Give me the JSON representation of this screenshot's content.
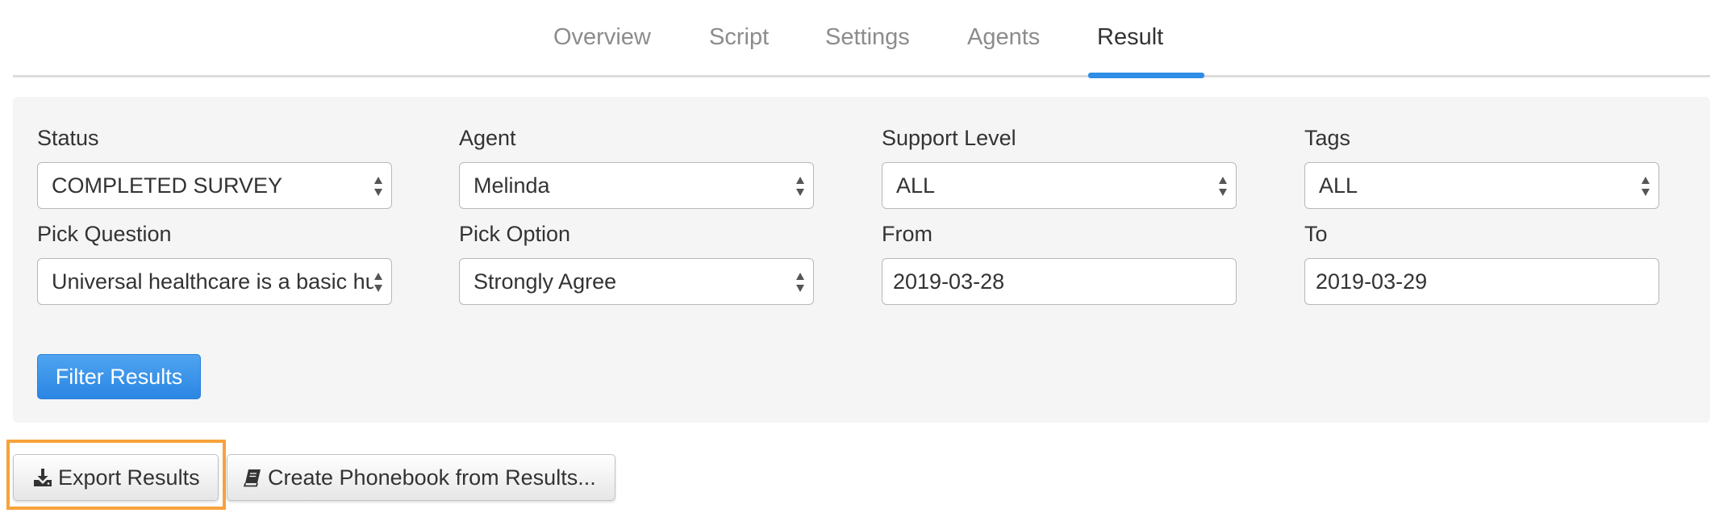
{
  "tabs": [
    {
      "label": "Overview",
      "active": false
    },
    {
      "label": "Script",
      "active": false
    },
    {
      "label": "Settings",
      "active": false
    },
    {
      "label": "Agents",
      "active": false
    },
    {
      "label": "Result",
      "active": true
    }
  ],
  "filters": {
    "status": {
      "label": "Status",
      "value": "COMPLETED SURVEY"
    },
    "agent": {
      "label": "Agent",
      "value": "Melinda"
    },
    "support_level": {
      "label": "Support Level",
      "value": "ALL"
    },
    "tags": {
      "label": "Tags",
      "value": "ALL"
    },
    "pick_question": {
      "label": "Pick Question",
      "value": "Universal healthcare is a basic hu"
    },
    "pick_option": {
      "label": "Pick Option",
      "value": "Strongly Agree"
    },
    "from": {
      "label": "From",
      "value": "2019-03-28"
    },
    "to": {
      "label": "To",
      "value": "2019-03-29"
    },
    "filter_button": "Filter Results"
  },
  "actions": {
    "export_label": "Export Results",
    "export_icon": "download-icon",
    "phonebook_label": "Create Phonebook from Results...",
    "phonebook_icon": "book-icon"
  },
  "colors": {
    "accent": "#2e8de5",
    "highlight": "#f7a23a",
    "panel_bg": "#f5f5f5"
  }
}
